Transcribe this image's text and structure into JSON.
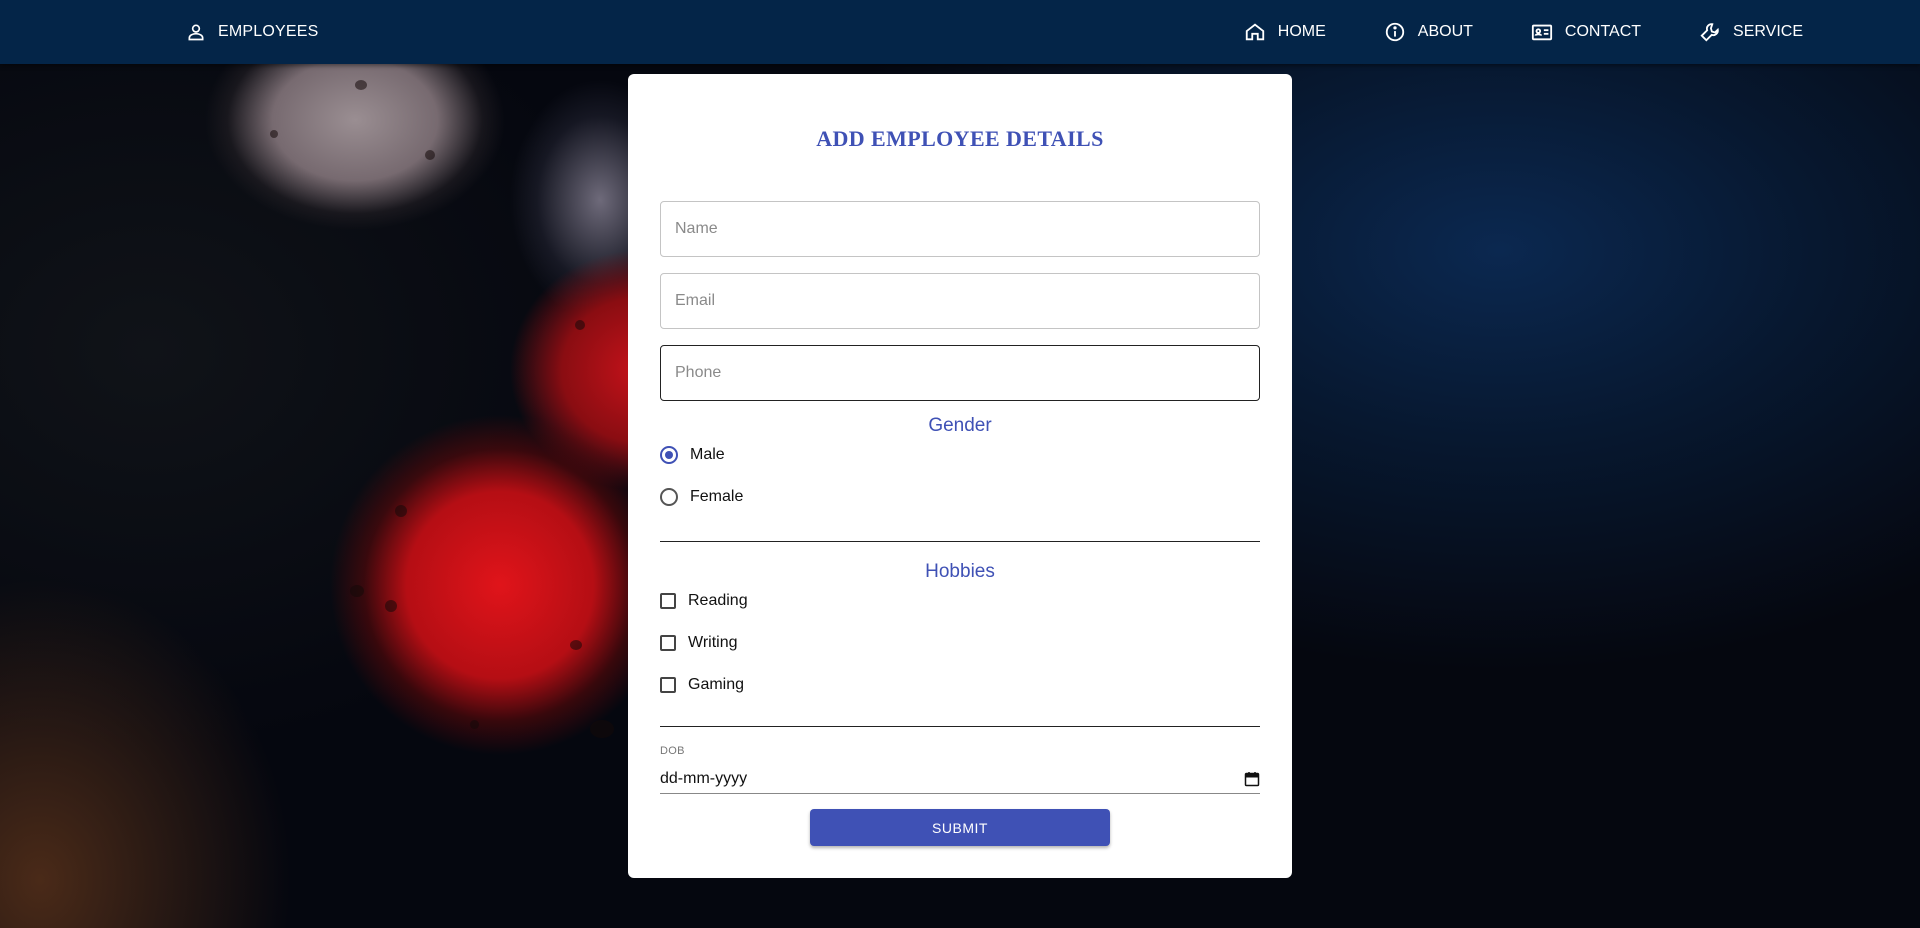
{
  "navbar": {
    "brand": {
      "icon": "person-icon",
      "label": "EMPLOYEES"
    },
    "links": [
      {
        "icon": "home-icon",
        "label": "HOME"
      },
      {
        "icon": "info-icon",
        "label": "ABOUT"
      },
      {
        "icon": "contact-card-icon",
        "label": "CONTACT"
      },
      {
        "icon": "wrench-icon",
        "label": "SERVICE"
      }
    ]
  },
  "form": {
    "title": "ADD EMPLOYEE DETAILS",
    "name": {
      "placeholder": "Name",
      "value": ""
    },
    "email": {
      "placeholder": "Email",
      "value": ""
    },
    "phone": {
      "placeholder": "Phone",
      "value": ""
    },
    "gender": {
      "label": "Gender",
      "options": [
        {
          "label": "Male",
          "checked": true
        },
        {
          "label": "Female",
          "checked": false
        }
      ]
    },
    "hobbies": {
      "label": "Hobbies",
      "options": [
        {
          "label": "Reading",
          "checked": false
        },
        {
          "label": "Writing",
          "checked": false
        },
        {
          "label": "Gaming",
          "checked": false
        }
      ]
    },
    "dob": {
      "label": "DOB",
      "value": "dd-mm-yyyy"
    },
    "submit_label": "SUBMIT"
  },
  "colors": {
    "navbar": "#042548",
    "accent": "#3f51b5"
  }
}
